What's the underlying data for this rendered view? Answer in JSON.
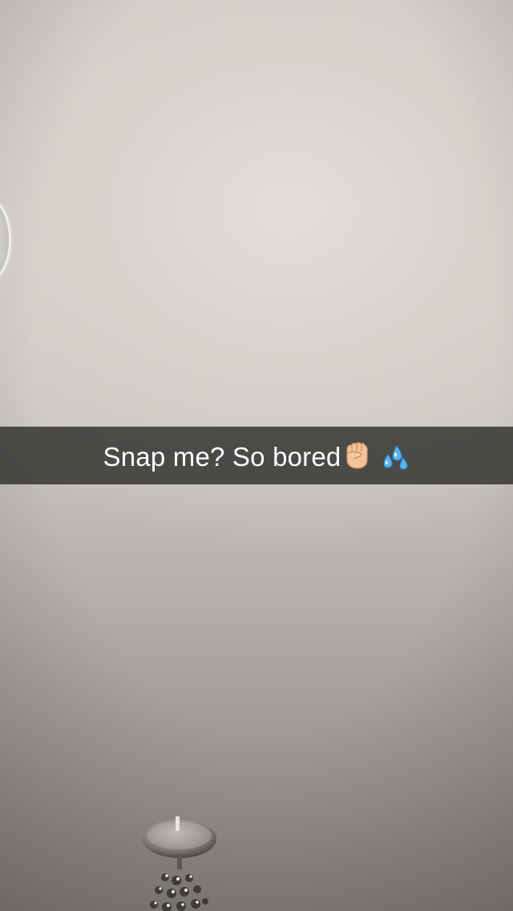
{
  "snap": {
    "caption": "Snap me? So bored",
    "emojis": [
      "raised-fist-icon",
      "sweat-droplets-icon"
    ]
  },
  "colors": {
    "caption_bar": "#323230",
    "caption_text": "#ffffff",
    "ceiling_light": "#e3e0db",
    "ceiling_shadow": "#85817d"
  }
}
